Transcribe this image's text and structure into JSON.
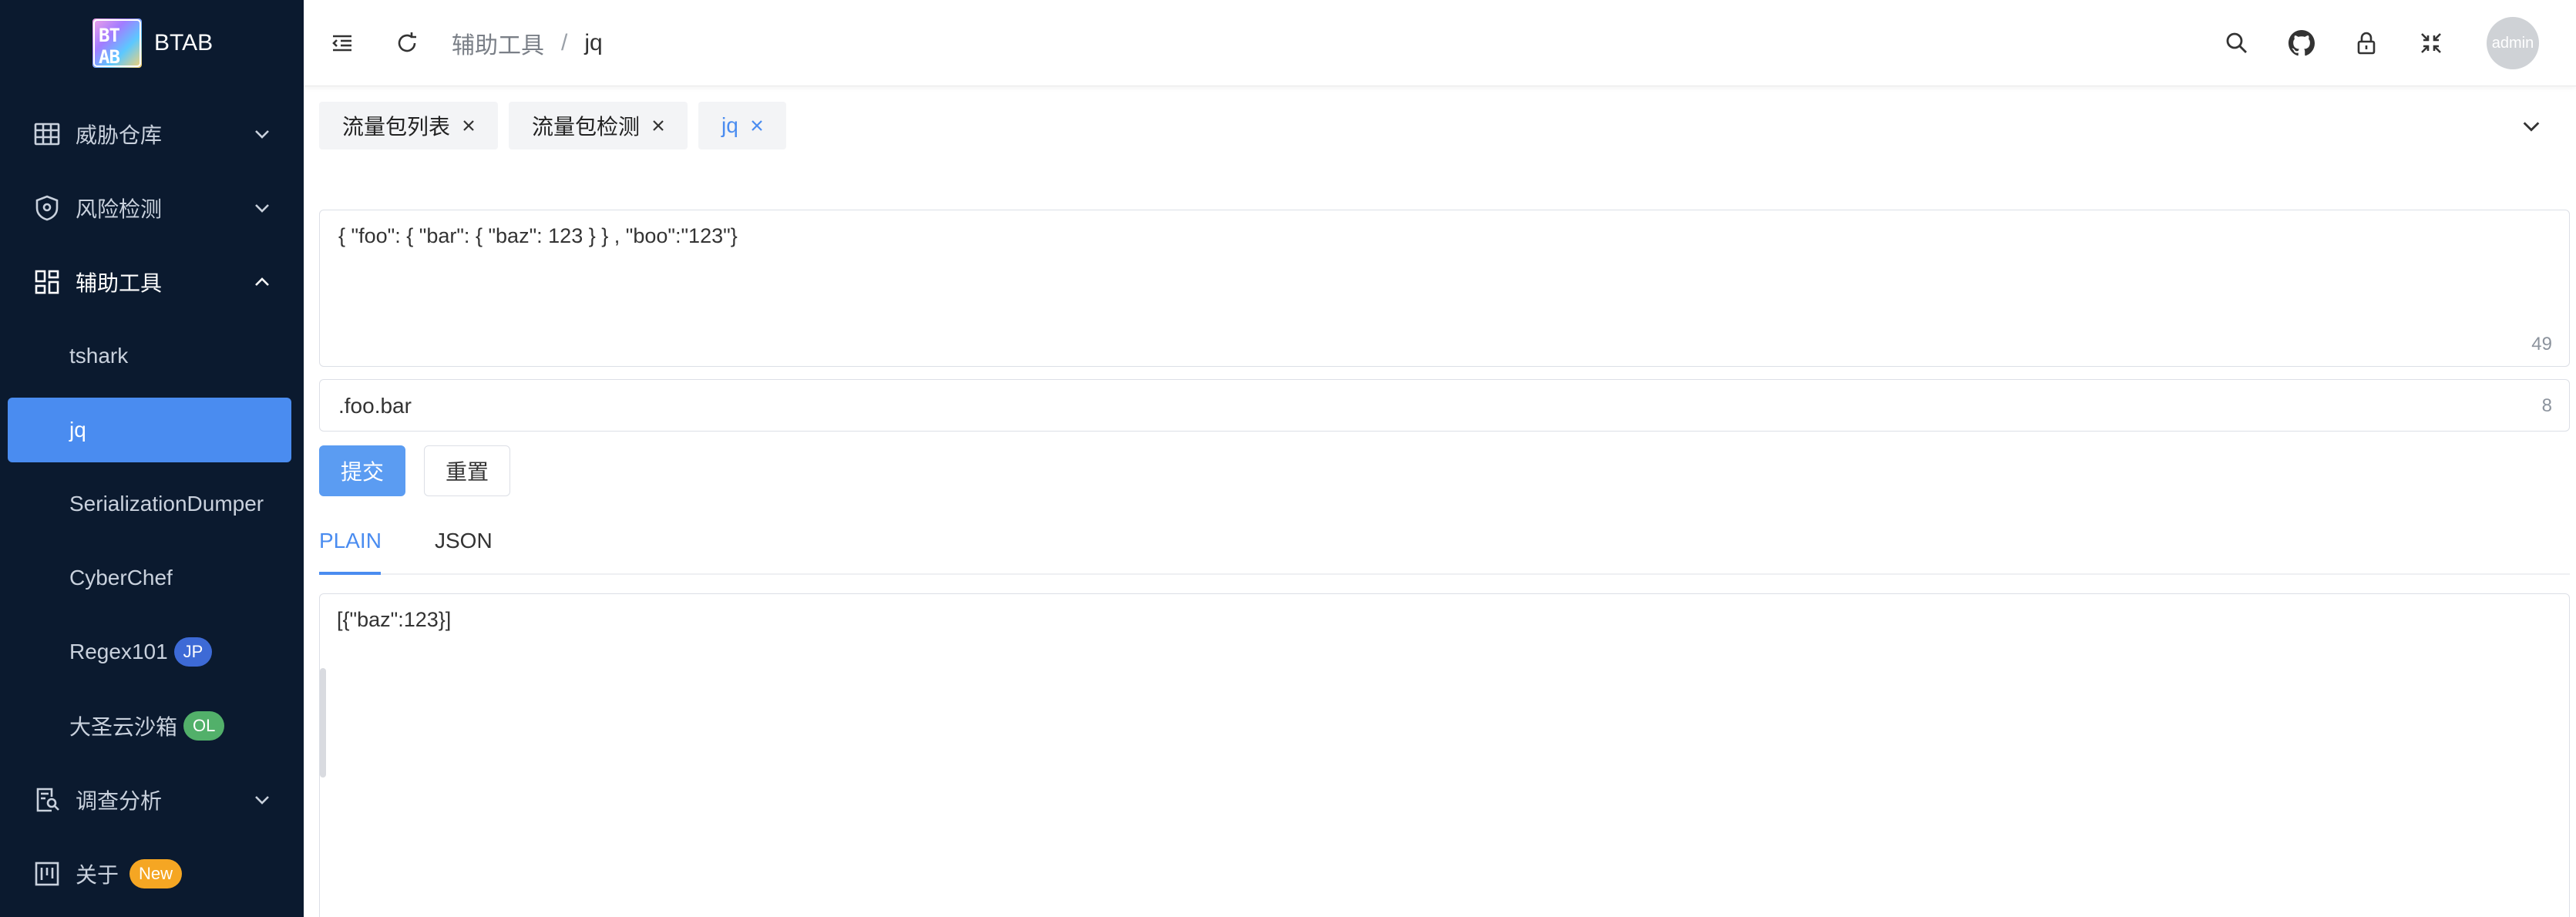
{
  "app": {
    "logo_text": "BTAB",
    "title": "BTAB"
  },
  "sidebar": {
    "menus": [
      {
        "label": "威胁仓库",
        "icon": "table-icon",
        "expanded": false
      },
      {
        "label": "风险检测",
        "icon": "shield-icon",
        "expanded": false
      },
      {
        "label": "辅助工具",
        "icon": "dashboard-icon",
        "expanded": true
      },
      {
        "label": "调查分析",
        "icon": "file-search-icon",
        "expanded": false
      },
      {
        "label": "关于",
        "icon": "project-icon",
        "badge": "New",
        "badge_color": "#f5a623"
      }
    ],
    "tools": [
      {
        "label": "tshark"
      },
      {
        "label": "jq",
        "active": true
      },
      {
        "label": "SerializationDumper"
      },
      {
        "label": "CyberChef"
      },
      {
        "label": "Regex101",
        "badge": "JP",
        "badge_color": "#3d6ad6"
      },
      {
        "label": "大圣云沙箱",
        "badge": "OL",
        "badge_color": "#52b06a"
      }
    ]
  },
  "header": {
    "breadcrumb": [
      "辅助工具",
      "jq"
    ],
    "separator": "/",
    "user": "admin",
    "icons": [
      "menu-fold-icon",
      "reload-icon",
      "search-icon",
      "github-icon",
      "lock-icon",
      "fullscreen-icon"
    ]
  },
  "tabs": [
    {
      "label": "流量包列表",
      "active": false
    },
    {
      "label": "流量包检测",
      "active": false
    },
    {
      "label": "jq",
      "active": true
    }
  ],
  "editor": {
    "json_input": "{ \"foo\": { \"bar\": { \"baz\": 123 } } , \"boo\":\"123\"}",
    "json_count": "49",
    "query": ".foo.bar",
    "query_count": "8",
    "submit_label": "提交",
    "reset_label": "重置"
  },
  "result": {
    "tabs": [
      "PLAIN",
      "JSON"
    ],
    "active_tab": "PLAIN",
    "output": "[{\"baz\":123}]"
  },
  "colors": {
    "sidebar_bg": "#0b1a2f",
    "accent": "#4a8cf0"
  }
}
